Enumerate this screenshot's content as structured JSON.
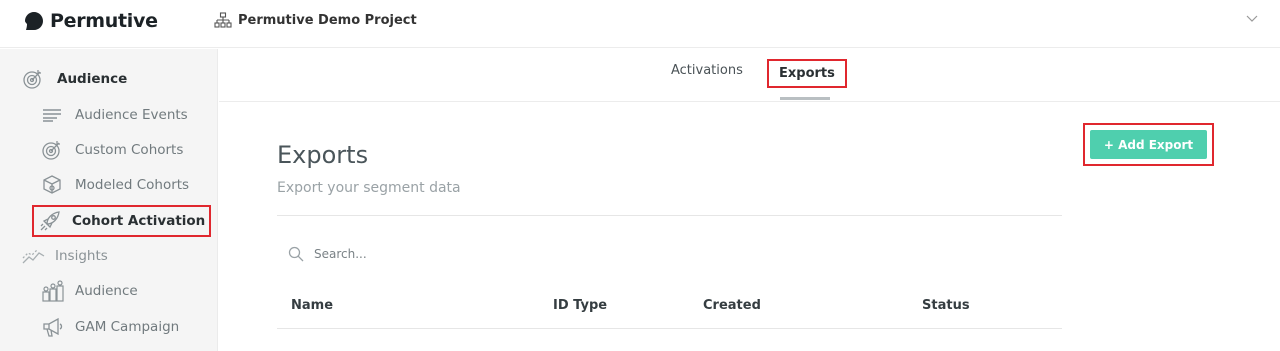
{
  "header": {
    "brand": "Permutive",
    "project_name": "Permutive Demo Project"
  },
  "sidebar": {
    "items": [
      {
        "label": "Audience",
        "icon": "target-icon"
      },
      {
        "label": "Audience Events",
        "icon": "lines-icon"
      },
      {
        "label": "Custom Cohorts",
        "icon": "target-icon"
      },
      {
        "label": "Modeled Cohorts",
        "icon": "cube-icon"
      },
      {
        "label": "Cohort Activation",
        "icon": "rocket-icon",
        "highlighted": true
      },
      {
        "label": "Insights",
        "icon": "trend-icon"
      },
      {
        "label": "Audience",
        "icon": "people-icon"
      },
      {
        "label": "GAM Campaign",
        "icon": "megaphone-icon"
      }
    ]
  },
  "tabs": [
    {
      "label": "Activations",
      "active": false
    },
    {
      "label": "Exports",
      "active": true
    }
  ],
  "main": {
    "title": "Exports",
    "subtitle": "Export your segment data",
    "add_button": "+ Add Export",
    "search_placeholder": "Search...",
    "columns": [
      "Name",
      "ID Type",
      "Created",
      "Status"
    ]
  },
  "colors": {
    "accent": "#4fcfae",
    "highlight": "#e0272e",
    "sidebar_bg": "#f5f5f5"
  }
}
